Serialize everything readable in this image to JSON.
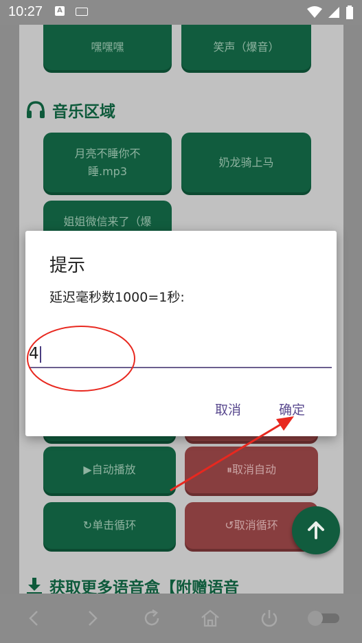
{
  "status_bar": {
    "time": "10:27",
    "a_badge": "A"
  },
  "buttons_top": [
    "嘿嘿嘿",
    "笑声（爆音）"
  ],
  "music_section": {
    "title": "音乐区域",
    "items": [
      "月亮不睡你不睡.mp3",
      "奶龙骑上马",
      "姐姐微信来了（爆"
    ]
  },
  "controls": {
    "auto_play": "▶自动播放",
    "cancel_auto": "⏸取消自动",
    "loop_click": "↻单击循环",
    "cancel_loop": "↺取消循环"
  },
  "more_section": {
    "title": "获取更多语音盒【附赠语音"
  },
  "dialog": {
    "title": "提示",
    "message": "延迟毫秒数1000=1秒:",
    "input_value": "4",
    "cancel": "取消",
    "confirm": "确定"
  },
  "colors": {
    "button_green": "#115c3e",
    "button_red": "#883e3f",
    "dialog_accent": "#5a4a8f",
    "annotation_red": "#e8281f"
  }
}
